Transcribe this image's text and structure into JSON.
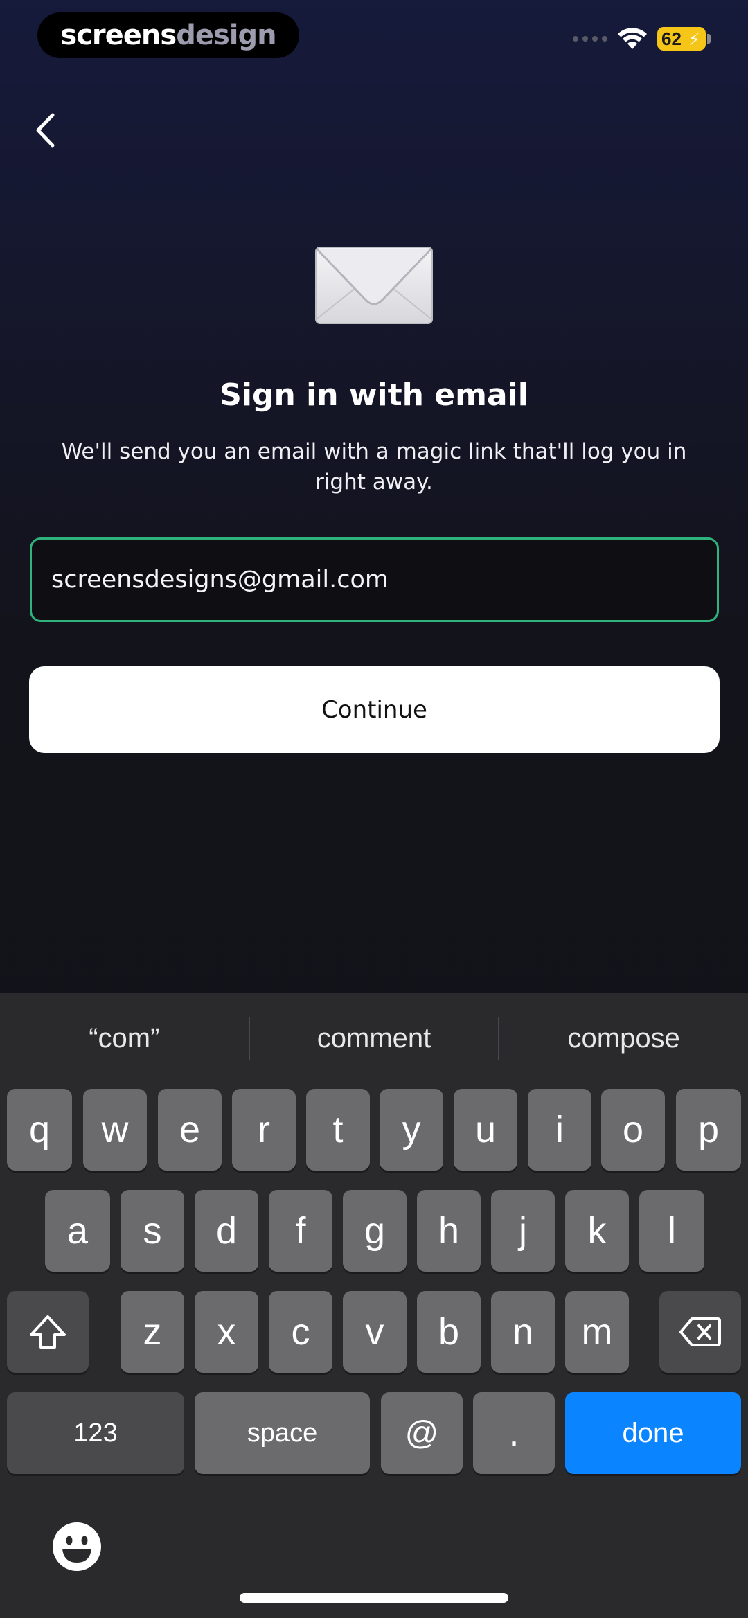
{
  "status_bar": {
    "brand_part1": "screens",
    "brand_part2": "design",
    "battery": "62"
  },
  "title": "Sign in with email",
  "subtitle": "We'll send you an email with a magic link that'll log you in right away.",
  "email": {
    "value": "screensdesigns@gmail.com"
  },
  "continue_label": "Continue",
  "colors": {
    "input_border": "#2fb27c",
    "done_key": "#0a84ff",
    "battery": "#f5c518"
  },
  "keyboard": {
    "suggestions": [
      "“com”",
      "comment",
      "compose"
    ],
    "row1": [
      "q",
      "w",
      "e",
      "r",
      "t",
      "y",
      "u",
      "i",
      "o",
      "p"
    ],
    "row2": [
      "a",
      "s",
      "d",
      "f",
      "g",
      "h",
      "j",
      "k",
      "l"
    ],
    "row3": [
      "z",
      "x",
      "c",
      "v",
      "b",
      "n",
      "m"
    ],
    "numbers_label": "123",
    "space_label": "space",
    "at_label": "@",
    "dot_label": ".",
    "done_label": "done"
  }
}
